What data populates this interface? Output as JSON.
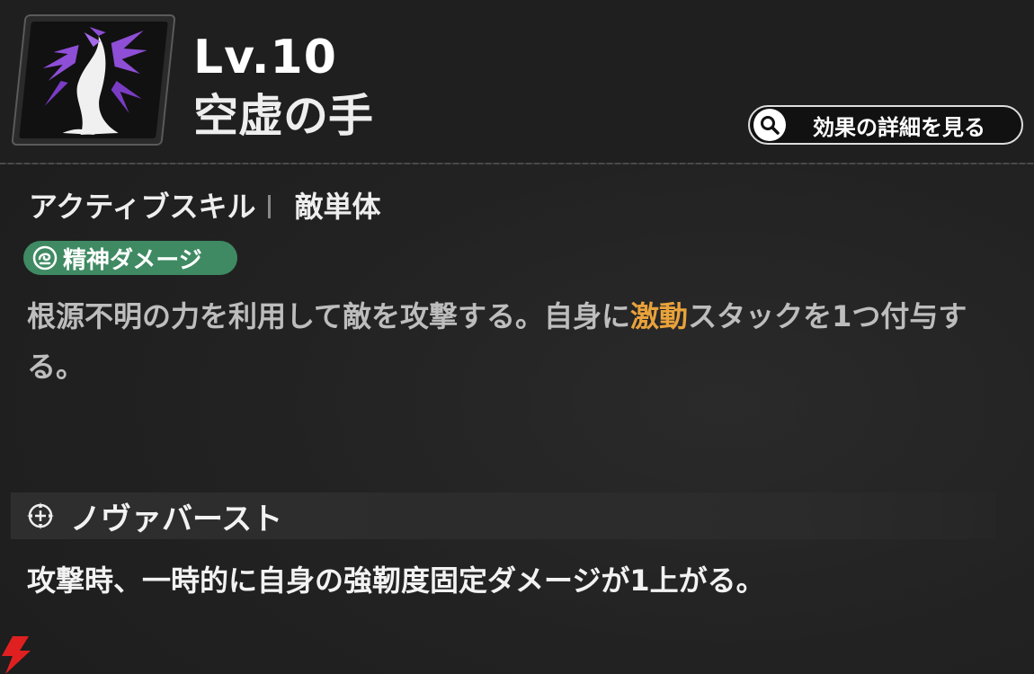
{
  "header": {
    "level": "Lv.10",
    "skill_name": "空虚の手",
    "detail_button_label": "効果の詳細を見る",
    "icon": "void-hand-icon"
  },
  "skill": {
    "type_label": "アクティブスキル",
    "target_label": "敵単体",
    "damage_tag": "精神ダメージ",
    "damage_tag_color": "#3f8a63",
    "description_before": "根源不明の力を利用して敵を攻撃する。自身に",
    "description_highlight": "激動",
    "description_after": "スタックを1つ付与する。",
    "highlight_color": "#e9a23b"
  },
  "burst": {
    "title": "ノヴァバースト",
    "description": "攻撃時、一時的に自身の強靭度固定ダメージが1上がる。"
  }
}
